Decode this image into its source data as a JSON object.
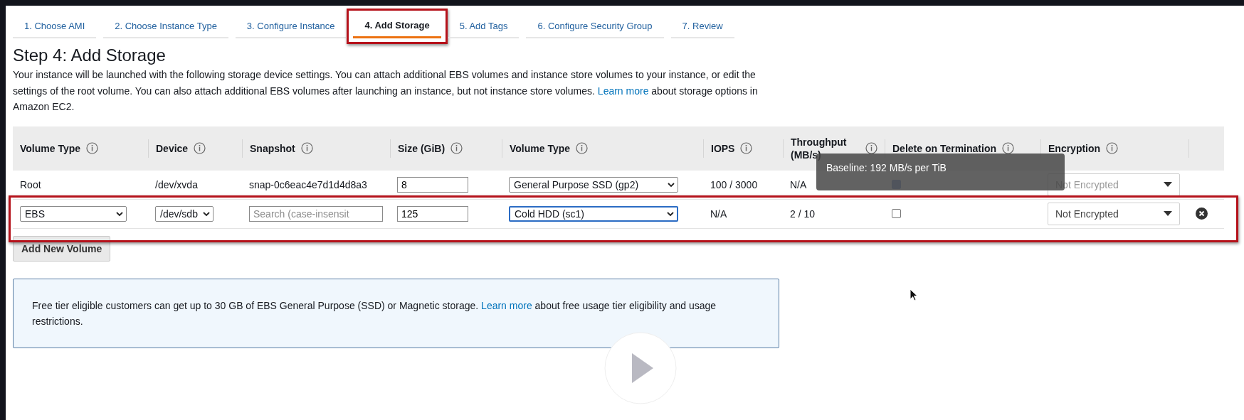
{
  "tabs": [
    {
      "label": "1. Choose AMI",
      "selected": false,
      "highlighted": false
    },
    {
      "label": "2. Choose Instance Type",
      "selected": false,
      "highlighted": false
    },
    {
      "label": "3. Configure Instance",
      "selected": false,
      "highlighted": false
    },
    {
      "label": "4. Add Storage",
      "selected": true,
      "highlighted": true
    },
    {
      "label": "5. Add Tags",
      "selected": false,
      "highlighted": false
    },
    {
      "label": "6. Configure Security Group",
      "selected": false,
      "highlighted": false
    },
    {
      "label": "7. Review",
      "selected": false,
      "highlighted": false
    }
  ],
  "title": "Step 4: Add Storage",
  "description": {
    "before": "Your instance will be launched with the following storage device settings. You can attach additional EBS volumes and instance store volumes to your instance, or edit the settings of the root volume. You can also attach additional EBS volumes after launching an instance, but not instance store volumes.",
    "link": "Learn more",
    "after": "about storage options in Amazon EC2."
  },
  "table": {
    "columns": [
      {
        "label": "Volume Type"
      },
      {
        "label": "Device"
      },
      {
        "label": "Snapshot"
      },
      {
        "label": "Size (GiB)"
      },
      {
        "label": "Volume Type"
      },
      {
        "label": "IOPS"
      },
      {
        "label": "Throughput (MB/s)"
      },
      {
        "label": "Delete on Termination"
      },
      {
        "label": "Encryption"
      }
    ],
    "rows": [
      {
        "highlighted": false,
        "cells": [
          {
            "kind": "text",
            "text": "Root"
          },
          {
            "kind": "text",
            "text": "/dev/xvda"
          },
          {
            "kind": "text",
            "text": "snap-0c6eac4e7d1d4d8a3"
          },
          {
            "kind": "input",
            "value": "8"
          },
          {
            "kind": "select",
            "value": "General Purpose SSD (gp2)",
            "focused": false
          },
          {
            "kind": "text",
            "text": "100 / 3000"
          },
          {
            "kind": "text",
            "text": "N/A"
          },
          {
            "kind": "checkbox",
            "checked": true,
            "disabled": true
          },
          {
            "kind": "dropdown",
            "value": "Not Encrypted",
            "disabled": true
          }
        ]
      },
      {
        "highlighted": true,
        "cells": [
          {
            "kind": "select",
            "value": "EBS",
            "focused": false
          },
          {
            "kind": "select",
            "value": "/dev/sdb",
            "focused": false
          },
          {
            "kind": "input",
            "placeholder": "Search (case-insensit"
          },
          {
            "kind": "input",
            "value": "125"
          },
          {
            "kind": "select",
            "value": "Cold HDD (sc1)",
            "focused": true
          },
          {
            "kind": "text",
            "text": "N/A"
          },
          {
            "kind": "text",
            "text": "2 / 10"
          },
          {
            "kind": "checkbox",
            "checked": false,
            "disabled": false
          },
          {
            "kind": "dropdown",
            "value": "Not Encrypted",
            "disabled": false
          },
          {
            "kind": "remove"
          }
        ]
      }
    ]
  },
  "tooltip": "Baseline: 192 MB/s per TiB",
  "add_button": "Add New Volume",
  "notice": {
    "before": "Free tier eligible customers can get up to 30 GB of EBS General Purpose (SSD) or Magnetic storage.",
    "link": "Learn more",
    "after": "about free usage tier eligibility and usage restrictions."
  }
}
